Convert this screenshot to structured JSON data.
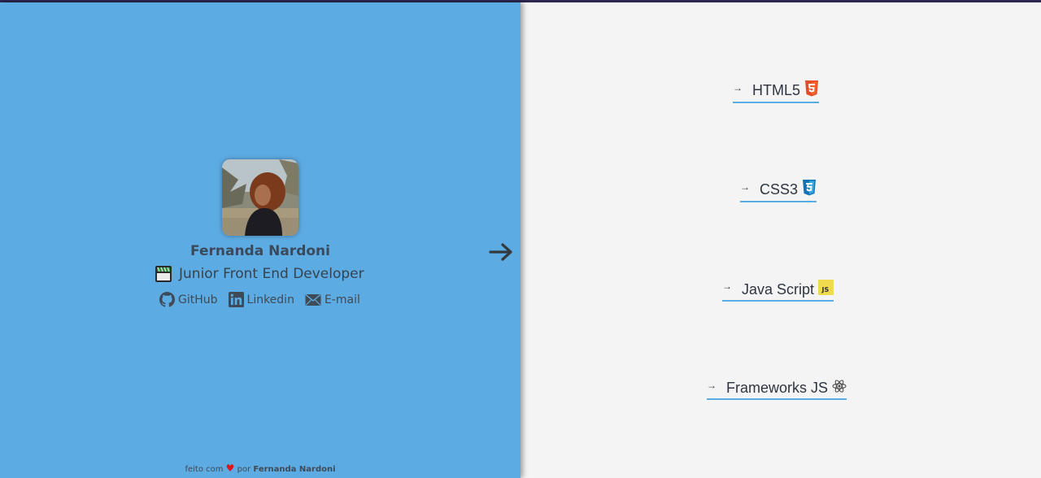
{
  "profile": {
    "name": "Fernanda Nardoni",
    "role": "Junior Front End Developer",
    "avatar_alt": "profile photo"
  },
  "socials": [
    {
      "label": "GitHub",
      "icon": "github-icon"
    },
    {
      "label": "Linkedin",
      "icon": "linkedin-icon"
    },
    {
      "label": "E-mail",
      "icon": "mail-icon"
    }
  ],
  "footer": {
    "prefix": "feito com",
    "middle": "por",
    "author": "Fernanda Nardoni"
  },
  "skills": [
    {
      "label": "HTML5",
      "icon": "html5-icon"
    },
    {
      "label": "CSS3",
      "icon": "css3-icon"
    },
    {
      "label": "Java Script",
      "icon": "js-icon"
    },
    {
      "label": "Frameworks JS",
      "icon": "react-icon"
    }
  ],
  "colors": {
    "left_bg": "#5dabe3",
    "right_bg": "#f4f4f4",
    "underline": "#5dabe3",
    "heart": "#e0141e"
  }
}
